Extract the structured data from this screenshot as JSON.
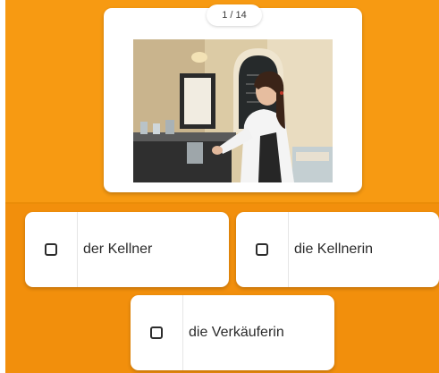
{
  "progress": {
    "counter": "1 / 14"
  },
  "question": {
    "image_subject": "waitress-photo"
  },
  "answers": [
    {
      "label": "der Kellner",
      "checked": false
    },
    {
      "label": "die Kellnerin",
      "checked": false
    },
    {
      "label": "die Verkäuferin",
      "checked": false
    }
  ],
  "colors": {
    "background_orange": "#f79a12",
    "background_orange_dark": "#f28f0c",
    "card_white": "#ffffff",
    "checkbox_border": "#2d2d2d",
    "text_dark": "#2b2b2b"
  }
}
